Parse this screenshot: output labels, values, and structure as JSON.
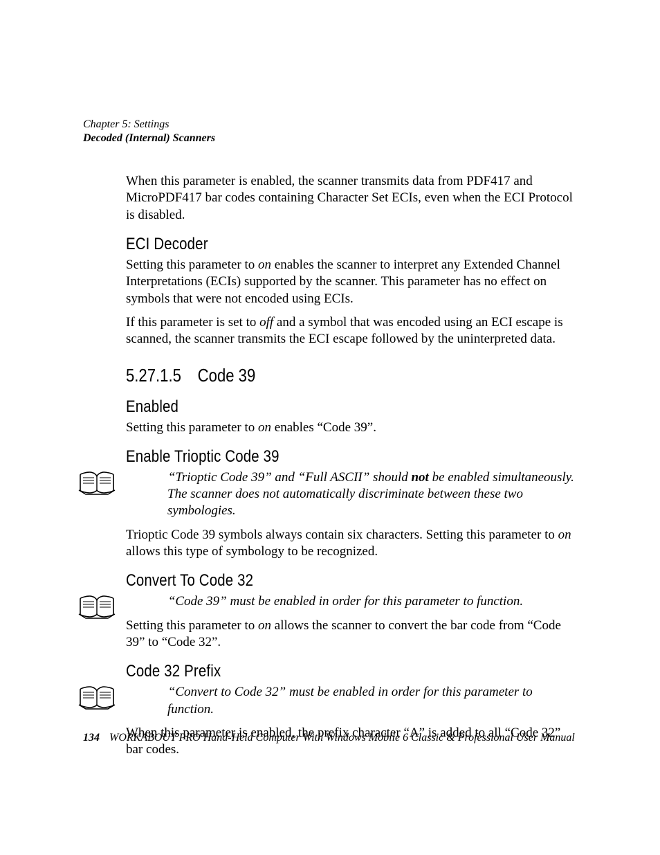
{
  "header": {
    "chapter": "Chapter 5: Settings",
    "subject": "Decoded (Internal) Scanners"
  },
  "intro_para": "When this parameter is enabled, the scanner transmits data from PDF417 and MicroPDF417 bar codes containing Character Set ECIs, even when the ECI Protocol is disabled.",
  "eci": {
    "heading": "ECI Decoder",
    "p1_a": "Setting this parameter to ",
    "p1_on": "on",
    "p1_b": " enables the scanner to interpret any Extended Channel Interpretations (ECIs) supported by the scanner. This parameter has no effect on symbols that were not encoded using ECIs.",
    "p2_a": "If this parameter is set to ",
    "p2_off": "off",
    "p2_b": " and a symbol that was encoded using an ECI escape is scanned, the scanner transmits the ECI escape followed by the uninterpreted data."
  },
  "section": {
    "number": "5.27.1.5",
    "title": "Code 39"
  },
  "enabled": {
    "heading": "Enabled",
    "p_a": "Setting this parameter to ",
    "p_on": "on",
    "p_b": " enables “Code 39”."
  },
  "trioptic": {
    "heading": "Enable Trioptic Code 39",
    "note_label": "Note:",
    "note_a": "“Trioptic Code 39” and “Full ASCII” should ",
    "note_not": "not",
    "note_b": " be enabled simultaneously. The scanner does not automatically discriminate between these two symbologies.",
    "p_a": "Trioptic Code 39 symbols always contain six characters. Setting this parameter to ",
    "p_on": "on",
    "p_b": " allows this type of symbology to be recognized."
  },
  "convert32": {
    "heading": "Convert To Code 32",
    "note_label": "Note:",
    "note_text": "“Code 39” must be enabled in order for this parameter to function.",
    "p_a": "Setting this parameter to ",
    "p_on": "on",
    "p_b": " allows the scanner to convert the bar code from “Code 39” to “Code 32”."
  },
  "prefix32": {
    "heading": "Code 32 Prefix",
    "note_label": "Note:",
    "note_text": "“Convert to Code 32” must be enabled in order for this parameter to function.",
    "p": "When this parameter is enabled, the prefix character “A” is added to all “Code 32” bar codes."
  },
  "footer": {
    "page": "134",
    "text": "WORKABOUT PRO Hand-Held Computer With Windows Mobile 6 Classic & Professional User Manual"
  }
}
